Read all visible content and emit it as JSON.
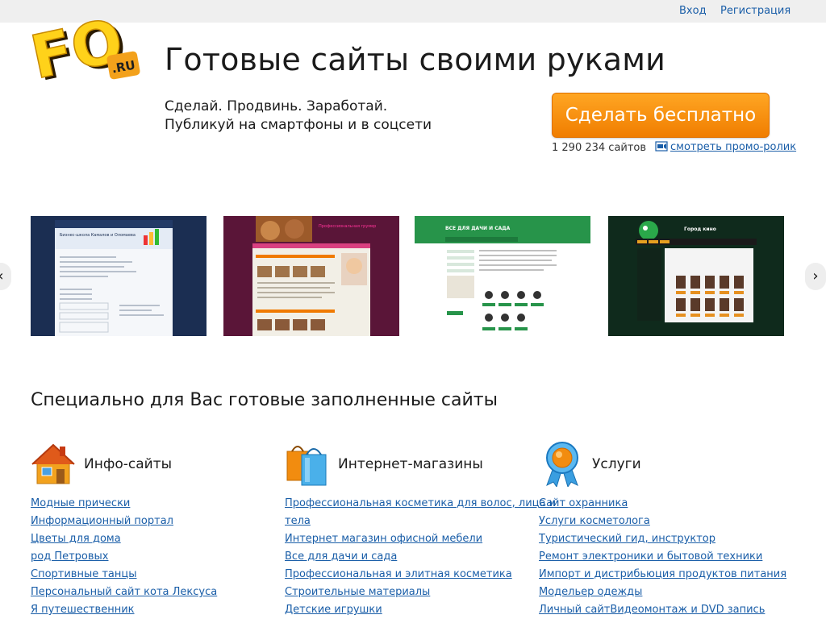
{
  "topbar": {
    "login": "Вход",
    "register": "Регистрация"
  },
  "logo": {
    "main": "FO",
    "sub": ".RU"
  },
  "hero": {
    "title": "Готовые сайты своими руками",
    "tagline1": "Сделай. Продвинь. Заработай.",
    "tagline2": "Публикуй на смартфоны и в соцсети",
    "cta": "Сделать бесплатно",
    "site_count": "1 290 234 сайтов",
    "promo": "смотреть промо-ролик"
  },
  "carousel": {
    "prev": "‹",
    "next": "›",
    "thumbs": [
      {
        "title": "Бизнес-школа Камалов и Оломаева",
        "theme": "dark-blue"
      },
      {
        "title": "Профессиональная грумер",
        "theme": "purple"
      },
      {
        "title": "ВСЕ ДЛЯ ДАЧИ И САДА",
        "theme": "green"
      },
      {
        "title": "Город кино",
        "theme": "dark"
      }
    ]
  },
  "section": {
    "title": "Специально для Вас готовые заполненные сайты"
  },
  "categories": [
    {
      "label": "Инфо-сайты",
      "icon": "house-icon",
      "links": [
        "Модные прически",
        "Информационный портал",
        "Цветы для дома",
        "род Петровых",
        "Спортивные танцы",
        "Персональный сайт кота Лексуса",
        "Я путешественник"
      ]
    },
    {
      "label": "Интернет-магазины",
      "icon": "shopping-bag-icon",
      "links": [
        "Профессиональная косметика для волос, лица и",
        "тела",
        "Интернет магазин офисной мебели",
        "Все для дачи и сада",
        "Профессиональная и элитная косметика",
        "Строительные материалы",
        "Детские игрушки"
      ]
    },
    {
      "label": "Услуги",
      "icon": "award-ribbon-icon",
      "links": [
        "Сайт охранника",
        "Услуги косметолога",
        "Туристический гид, инструктор",
        "Ремонт электроники и бытовой техники",
        "Импорт и дистрибьюция продуктов питания",
        "Модельер одежды",
        "Личный сайтВидеомонтаж и DVD запись"
      ]
    }
  ],
  "colors": {
    "accent": "#f28c0f",
    "link": "#1a5ea8",
    "topbar": "#efefef"
  }
}
